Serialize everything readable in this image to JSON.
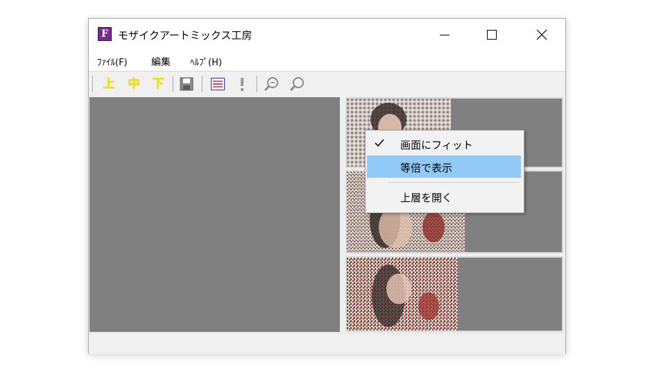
{
  "window": {
    "title": "モザイクアートミックス工房",
    "icon_letter": "F",
    "controls": [
      "minimize-icon",
      "maximize-icon",
      "close-icon"
    ]
  },
  "menu": {
    "file": "ﾌｧｲﾙ(F)",
    "edit": "編集",
    "help": "ﾍﾙﾌﾟ(H)"
  },
  "toolbar": {
    "upper": "上",
    "middle": "中",
    "lower": "下",
    "icons": [
      "save-icon",
      "list-icon",
      "exclamation-icon",
      "zoom-fit-icon",
      "zoom-icon"
    ]
  },
  "context_menu": {
    "items": [
      {
        "label": "画面にフィット",
        "checked": true,
        "highlighted": false
      },
      {
        "label": "等倍で表示",
        "checked": false,
        "highlighted": true
      },
      {
        "label": "上層を開く",
        "checked": false,
        "highlighted": false
      }
    ]
  },
  "colors": {
    "pane_gray": "#808080",
    "highlight": "#91c9f7",
    "toolbar_yellow": "#f2e600"
  }
}
